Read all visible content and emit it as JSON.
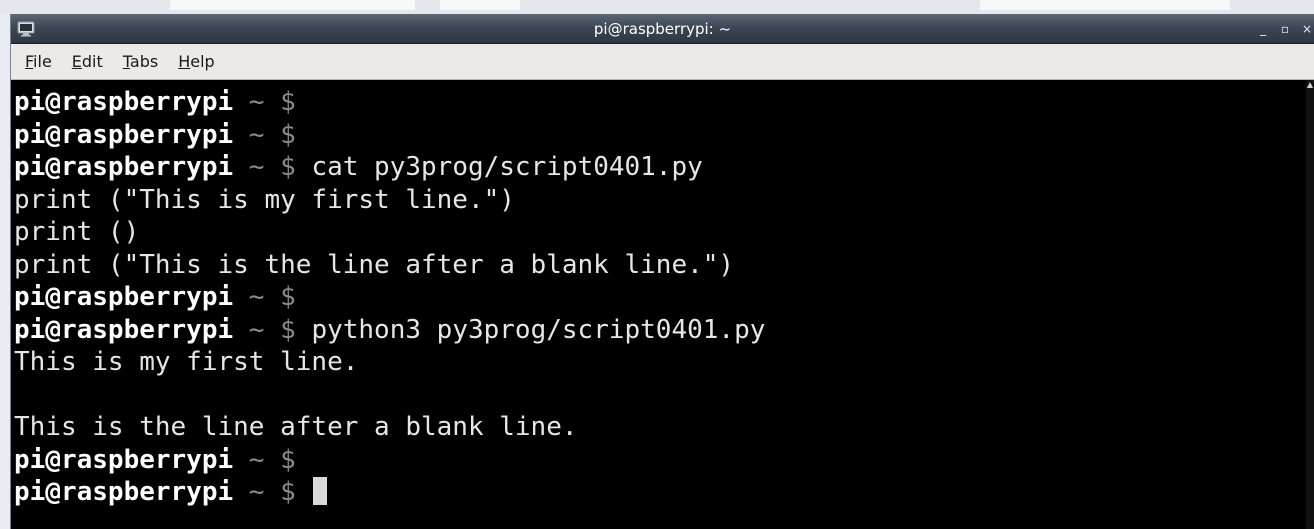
{
  "window": {
    "title": "pi@raspberrypi: ~",
    "controls": {
      "minimize": "_",
      "maximize": "▫",
      "close": "×"
    },
    "icon": "terminal-icon"
  },
  "menubar": {
    "items": [
      {
        "label": "File",
        "mnemonic": "F",
        "rest": "ile"
      },
      {
        "label": "Edit",
        "mnemonic": "E",
        "rest": "dit"
      },
      {
        "label": "Tabs",
        "mnemonic": "T",
        "rest": "abs"
      },
      {
        "label": "Help",
        "mnemonic": "H",
        "rest": "elp"
      }
    ]
  },
  "terminal": {
    "prompt_user": "pi@raspberrypi",
    "prompt_rest": " ~ $",
    "lines": [
      {
        "kind": "prompt",
        "command": ""
      },
      {
        "kind": "prompt",
        "command": ""
      },
      {
        "kind": "prompt",
        "command": "cat py3prog/script0401.py"
      },
      {
        "kind": "output",
        "text": "print (\"This is my first line.\")"
      },
      {
        "kind": "output",
        "text": "print ()"
      },
      {
        "kind": "output",
        "text": "print (\"This is the line after a blank line.\")"
      },
      {
        "kind": "prompt",
        "command": ""
      },
      {
        "kind": "prompt",
        "command": "python3 py3prog/script0401.py"
      },
      {
        "kind": "output",
        "text": "This is my first line."
      },
      {
        "kind": "output",
        "text": ""
      },
      {
        "kind": "output",
        "text": "This is the line after a blank line."
      },
      {
        "kind": "prompt",
        "command": ""
      },
      {
        "kind": "prompt",
        "command": "",
        "cursor": true
      }
    ]
  },
  "colors": {
    "terminal_bg": "#000000",
    "prompt_user": "#ffffff",
    "prompt_path": "#8a8a8a",
    "text": "#e6e6e6",
    "titlebar": "#3e4755",
    "menubar_bg": "#eceae6"
  }
}
